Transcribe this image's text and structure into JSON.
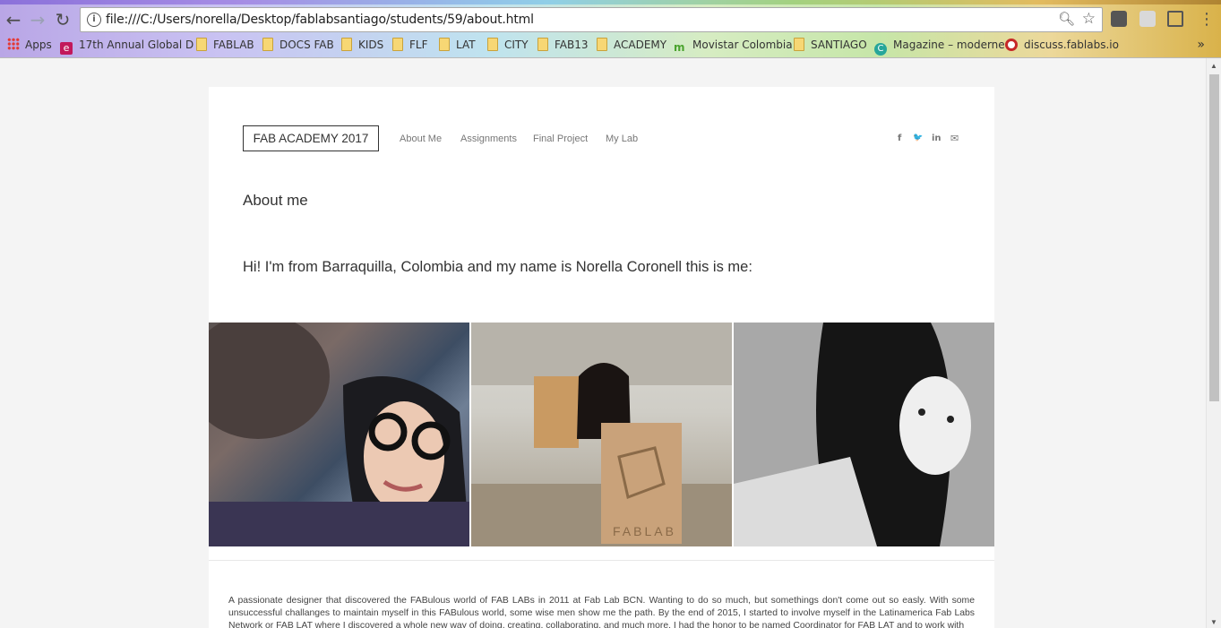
{
  "browser": {
    "url": "file:///C:/Users/norella/Desktop/fablabsantiago/students/59/about.html",
    "bookmarks": [
      {
        "label": "Apps",
        "icon": "apps-grid-icon"
      },
      {
        "label": "17th Annual Global D",
        "icon": "e-icon"
      },
      {
        "label": "FABLAB",
        "icon": "folder-icon"
      },
      {
        "label": "DOCS FAB",
        "icon": "folder-icon"
      },
      {
        "label": "KIDS",
        "icon": "folder-icon"
      },
      {
        "label": "FLF",
        "icon": "folder-icon"
      },
      {
        "label": "LAT",
        "icon": "folder-icon"
      },
      {
        "label": "CITY",
        "icon": "folder-icon"
      },
      {
        "label": "FAB13",
        "icon": "folder-icon"
      },
      {
        "label": "ACADEMY",
        "icon": "folder-icon"
      },
      {
        "label": "Movistar Colombia",
        "icon": "movistar-icon"
      },
      {
        "label": "SANTIAGO",
        "icon": "folder-icon"
      },
      {
        "label": "Magazine – moderne",
        "icon": "c-icon"
      },
      {
        "label": "discuss.fablabs.io",
        "icon": "discourse-icon"
      }
    ],
    "bookmarks_more": "»"
  },
  "site": {
    "logo": "FAB ACADEMY 2017",
    "nav": [
      "About Me",
      "Assignments",
      "Final Project",
      "My Lab"
    ],
    "social": {
      "facebook": "f",
      "twitter": "🐦",
      "linkedin": "in",
      "email": "✉"
    }
  },
  "content": {
    "heading": "About me",
    "intro": "Hi! I'm from Barraquilla, Colombia and my name is Norella Coronell this is me:",
    "photos": [
      {
        "alt": "selfie-with-glasses"
      },
      {
        "alt": "holding-fablab-sign"
      },
      {
        "alt": "black-and-white-portrait"
      }
    ],
    "bio": "A passionate designer that discovered the FABulous world of FAB LABs in 2011 at Fab Lab BCN. Wanting to do so much, but somethings don't come out so easly. With some unsuccessful challanges to maintain myself in this FABulous world, some wise men show me the path. By the end of 2015, I started to involve myself in the Latinamerica Fab Labs Network or FAB LAT where I discovered a whole new way of doing, creating, collaborating, and much more. I had the honor to be named Coordinator for FAB LAT and to work with"
  }
}
